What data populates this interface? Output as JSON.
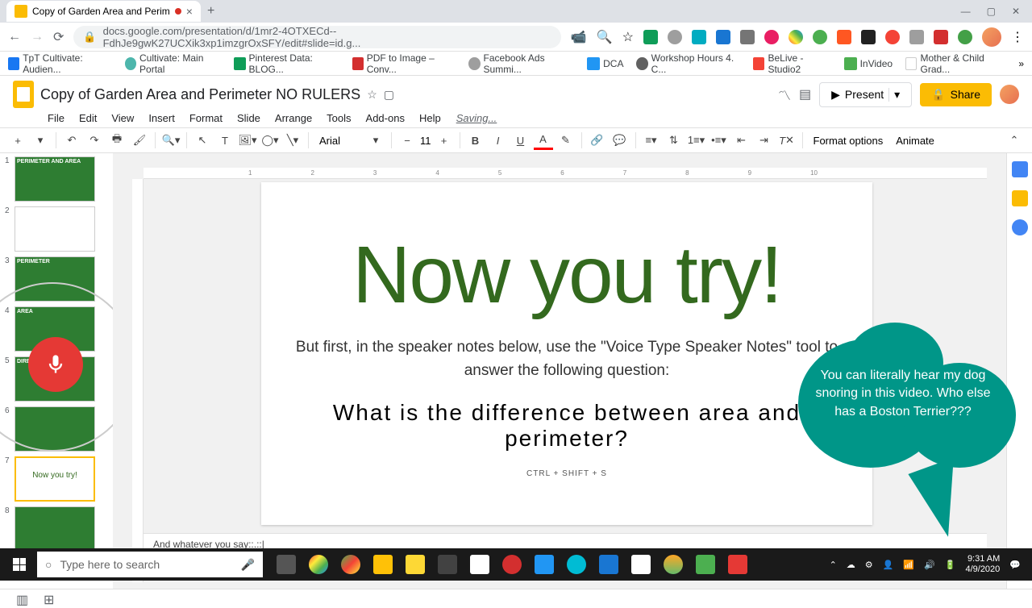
{
  "browser": {
    "tab_title": "Copy of Garden Area and Perim",
    "url": "docs.google.com/presentation/d/1mr2-4OTXECd--FdhJe9gwK27UCXik3xp1imzgrOxSFY/edit#slide=id.g...",
    "bookmarks": [
      "TpT Cultivate: Audien...",
      "Cultivate: Main Portal",
      "Pinterest Data: BLOG...",
      "PDF to Image – Conv...",
      "Facebook Ads Summi...",
      "DCA",
      "Workshop Hours 4. C...",
      "BeLive - Studio2",
      "InVideo",
      "Mother & Child Grad..."
    ]
  },
  "doc": {
    "title": "Copy of Garden Area and Perimeter NO RULERS",
    "menus": [
      "File",
      "Edit",
      "View",
      "Insert",
      "Format",
      "Slide",
      "Arrange",
      "Tools",
      "Add-ons",
      "Help"
    ],
    "saving": "Saving...",
    "present": "Present",
    "share": "Share"
  },
  "toolbar": {
    "font": "Arial",
    "size": "11",
    "format_options": "Format options",
    "animate": "Animate"
  },
  "slides": [
    {
      "num": "1",
      "title": "PERIMETER AND AREA"
    },
    {
      "num": "2",
      "title": ""
    },
    {
      "num": "3",
      "title": "PERIMETER"
    },
    {
      "num": "4",
      "title": "AREA"
    },
    {
      "num": "5",
      "title": "DIRECTIONS"
    },
    {
      "num": "6",
      "title": ""
    },
    {
      "num": "7",
      "title": "Now you try!"
    },
    {
      "num": "8",
      "title": ""
    }
  ],
  "canvas": {
    "heading": "Now you try!",
    "body": "But first, in the speaker notes below, use the \"Voice Type Speaker Notes\" tool to answer the following question:",
    "question": "What is the difference between area and perimeter?",
    "hint": "CTRL + SHIFT + S"
  },
  "notes": "And whatever you say::.::|",
  "cloud": "You can literally hear my dog snoring in this video.  Who else has a Boston Terrier???",
  "taskbar": {
    "search_placeholder": "Type here to search",
    "time": "9:31 AM",
    "date": "4/9/2020"
  },
  "ruler": [
    "1",
    "2",
    "3",
    "4",
    "5",
    "6",
    "7",
    "8",
    "9",
    "10"
  ]
}
